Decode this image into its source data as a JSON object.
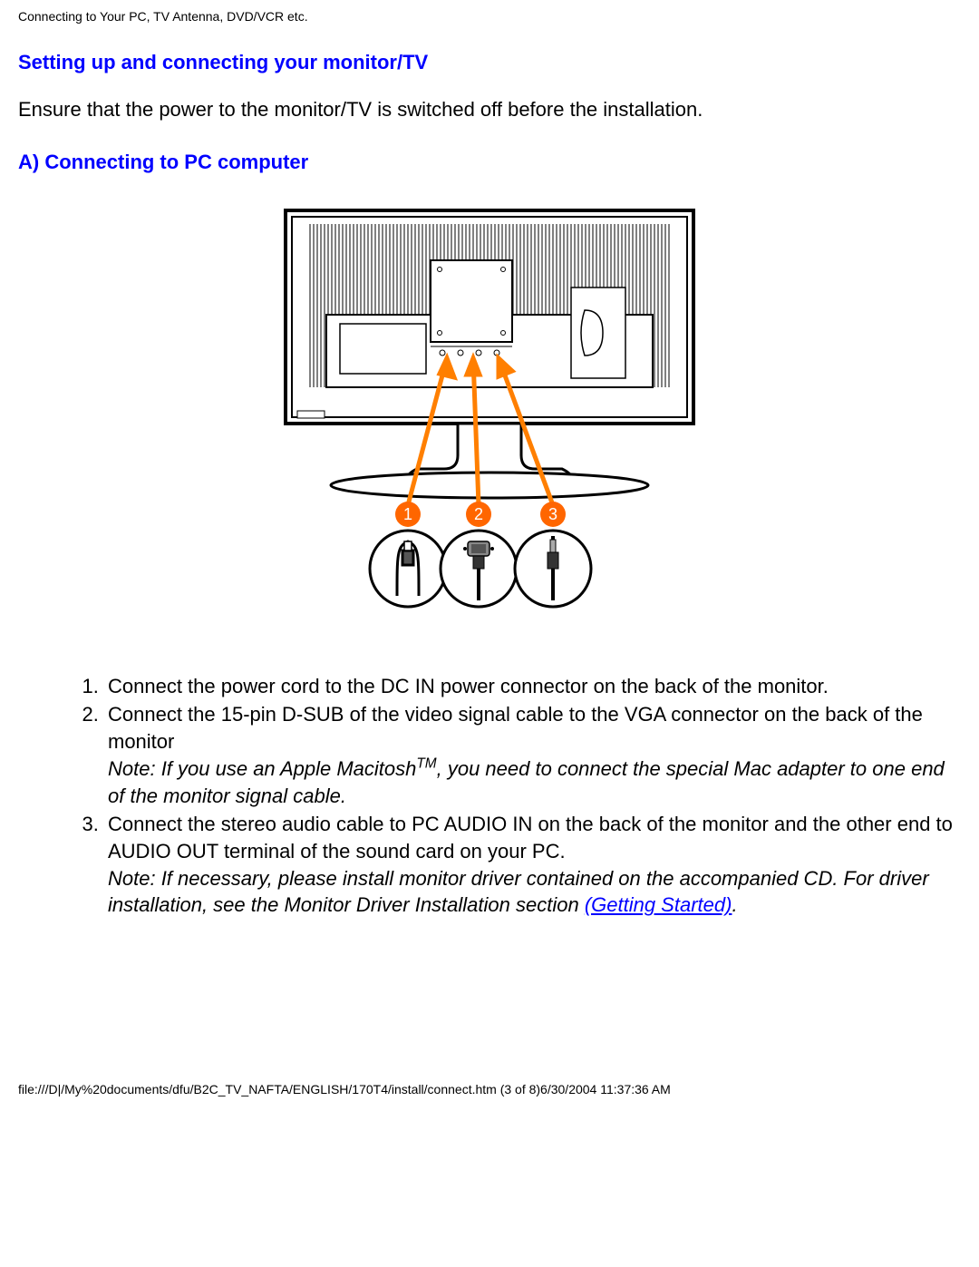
{
  "header": {
    "breadcrumb": "Connecting to Your PC, TV Antenna, DVD/VCR etc."
  },
  "headings": {
    "setup": "Setting up and connecting your monitor/TV",
    "sectionA": "A) Connecting to PC computer"
  },
  "intro": "Ensure that the power to the monitor/TV is switched off before the installation.",
  "diagram": {
    "callouts": [
      "1",
      "2",
      "3"
    ]
  },
  "steps": {
    "s1": "Connect the power cord to the DC IN power connector on the back of the monitor.",
    "s2": "Connect the 15-pin D-SUB of the video signal cable to the VGA connector on the back of the monitor",
    "s2_note_a": "Note: If you use an Apple Macitosh",
    "s2_tm": "TM",
    "s2_note_b": ", you need to connect the special Mac adapter to one end of the monitor signal cable.",
    "s3": "Connect the stereo audio cable to PC AUDIO IN on the back of the monitor and the other end to AUDIO OUT terminal of the sound card on your PC.",
    "s3_note": "Note: If necessary, please install monitor driver contained on the accompanied CD. For driver installation, see the Monitor Driver Installation section ",
    "s3_link": "(Getting Started)",
    "s3_period": "."
  },
  "footer": {
    "path": "file:///D|/My%20documents/dfu/B2C_TV_NAFTA/ENGLISH/170T4/install/connect.htm (3 of 8)6/30/2004 11:37:36 AM"
  }
}
